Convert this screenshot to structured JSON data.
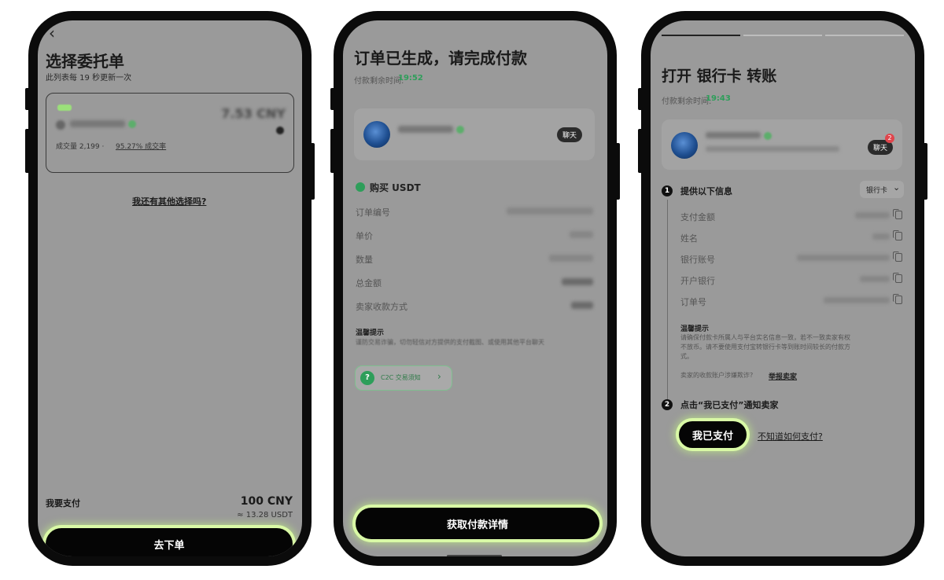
{
  "screen1": {
    "back_glyph": "‹",
    "title": "选择委托单",
    "subtitle": "此列表每 19 秒更新一次",
    "offer": {
      "stats_text": "成交量 2,199 ·",
      "completion_rate": "95.27% 成交率",
      "price_blurred": "7.53 CNY"
    },
    "more_options_link": "我还有其他选择吗?",
    "pay_label": "我要支付",
    "pay_amount": "100 CNY",
    "pay_usdt": "≈ 13.28 USDT",
    "submit_button": "去下单"
  },
  "screen2": {
    "title": "订单已生成，请完成付款",
    "timer_label": "付款剩余时间:",
    "timer_value": "19:52",
    "chat_button": "聊天",
    "buy_label": "购买 USDT",
    "rows": [
      {
        "label": "订单编号"
      },
      {
        "label": "单价"
      },
      {
        "label": "数量"
      },
      {
        "label": "总金额"
      },
      {
        "label": "卖家收款方式"
      }
    ],
    "tip_title": "温馨提示",
    "tip_text": "谨防交易诈骗，切勿轻信对方提供的支付截图、或使用其他平台聊天",
    "c2c_notice": "C2C 交易须知",
    "cta_button": "获取付款详情"
  },
  "screen3": {
    "title": "打开 银行卡 转账",
    "timer_label": "付款剩余时间:",
    "timer_value": "19:43",
    "chat_button": "聊天",
    "chat_badge": "2",
    "step1_num": "1",
    "step1_title": "提供以下信息",
    "method_select": "银行卡",
    "fields": [
      {
        "label": "支付金额"
      },
      {
        "label": "姓名"
      },
      {
        "label": "银行账号"
      },
      {
        "label": "开户银行"
      },
      {
        "label": "订单号"
      }
    ],
    "tip_title": "温馨提示",
    "tip_text_1": "请确保付款卡所属人与平台实名信息一致，若不一致卖家有权",
    "tip_text_2": "不放币。请不要使用支付宝转银行卡等到账时间较长的付款方",
    "tip_text_3": "式。",
    "report_prefix": "卖家的收款账户涉嫌欺诈?",
    "report_link": "举报卖家",
    "step2_num": "2",
    "step2_title": "点击“我已支付”通知卖家",
    "paid_button": "我已支付",
    "help_link": "不知道如何支付?"
  },
  "colors": {
    "highlight_glow": "#d9f9a6",
    "timer_green": "#2e9e5a",
    "screen_bg": "#9a9a9a"
  }
}
